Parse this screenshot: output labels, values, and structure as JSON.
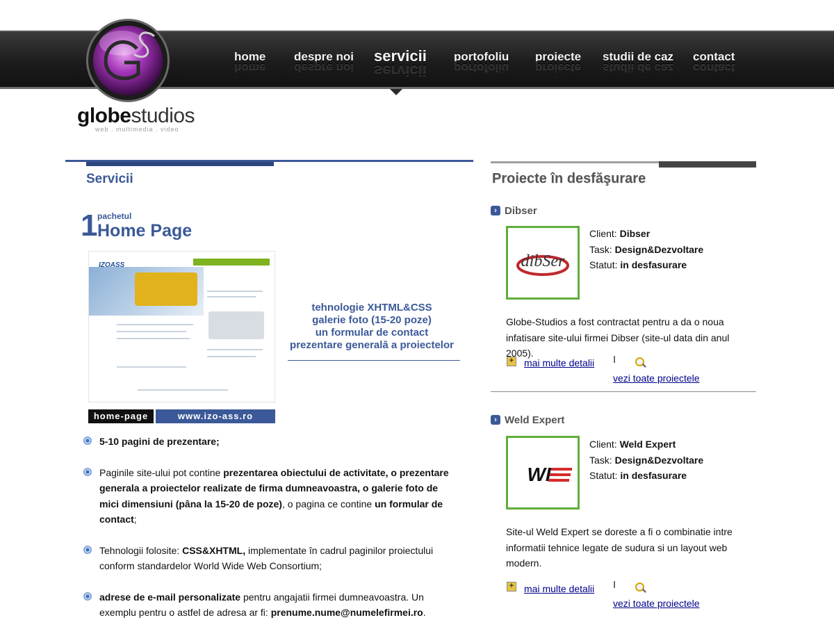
{
  "logo": {
    "word_bold": "globe",
    "word_light": "studios",
    "tagline": "web . multimedia . video"
  },
  "nav": {
    "items": [
      {
        "label": "home"
      },
      {
        "label": "despre noi"
      },
      {
        "label": "servicii"
      },
      {
        "label": "portofoliu"
      },
      {
        "label": "proiecte"
      },
      {
        "label": "studii de caz"
      },
      {
        "label": "contact"
      }
    ],
    "active_item": "servicii"
  },
  "services": {
    "section_title": "Servicii",
    "package": {
      "number": "1",
      "small": "pachetul",
      "big": "Home Page"
    },
    "preview": {
      "logo_text": "IZOASS",
      "label": "home-page",
      "url": "www.izo-ass.ro"
    },
    "tech": [
      "tehnologie XHTML&CSS",
      "galerie foto (15-20 poze)",
      "un formular de contact",
      "prezentare generală a proiectelor"
    ],
    "bullets": [
      {
        "parts": [
          {
            "b": true,
            "t": "5-10 pagini de prezentare;"
          }
        ]
      },
      {
        "parts": [
          {
            "b": false,
            "t": "Paginile site-ului pot contine "
          },
          {
            "b": true,
            "t": "prezentarea obiectului de activitate, o prezentare generala a proiectelor realizate de firma dumneavoastra, o galerie foto de mici dimensiuni (pâna la 15-20 de poze)"
          },
          {
            "b": false,
            "t": ", o pagina ce contine "
          },
          {
            "b": true,
            "t": "un formular de contact"
          },
          {
            "b": false,
            "t": ";"
          }
        ]
      },
      {
        "parts": [
          {
            "b": false,
            "t": "Tehnologii folosite: "
          },
          {
            "b": true,
            "t": "CSS&XHTML,"
          },
          {
            "b": false,
            "t": " implementate în cadrul paginilor proiectului conform standardelor World Wide Web Consortium;"
          }
        ]
      },
      {
        "parts": [
          {
            "b": true,
            "t": "adrese de e-mail personalizate"
          },
          {
            "b": false,
            "t": " pentru angajatii firmei dumneavoastra. Un exemplu pentru o astfel de adresa ar fi: "
          },
          {
            "b": true,
            "t": "prenume.nume@numelefirmei.ro"
          },
          {
            "b": false,
            "t": "."
          }
        ]
      }
    ]
  },
  "projects": {
    "title": "Proiecte în desfăşurare",
    "client_label": "Client:",
    "task_label": "Task:",
    "status_label": "Statut:",
    "more_link": "mai multe detalii",
    "all_link": "vezi toate proiectele",
    "separator": "I",
    "items": [
      {
        "name": "Dibser",
        "logo_text": "dibSer",
        "client": "Dibser",
        "task": "Design&Dezvoltare",
        "status": "in desfasurare",
        "description": "Globe-Studios a fost contractat pentru a da o noua infatisare site-ului firmei Dibser (site-ul data din anul 2005)."
      },
      {
        "name": "Weld Expert",
        "logo_text": "WE",
        "client": "Weld Expert",
        "task": "Design&Dezvoltare",
        "status": "in desfasurare",
        "description": "Site-ul Weld Expert se doreste a fi o combinatie intre informatii tehnice legate de sudura si un layout web modern."
      }
    ]
  }
}
